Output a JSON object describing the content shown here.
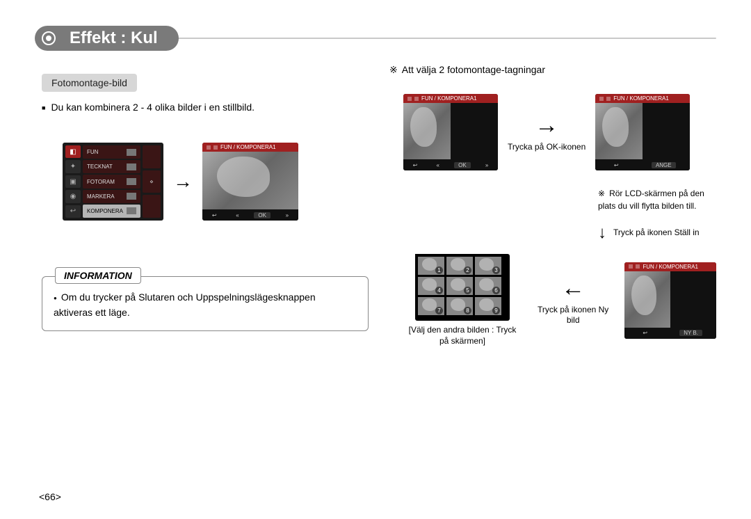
{
  "title": "Effekt : Kul",
  "subheading": "Fotomontage-bild",
  "intro_text": "Du kan kombinera 2 - 4 olika bilder i en stillbild.",
  "menu": {
    "items": [
      "FUN",
      "TECKNAT",
      "FOTORAM",
      "MARKERA",
      "KOMPONERA"
    ]
  },
  "screen_header": "FUN / KOMPONERA1",
  "footer_ok": "OK",
  "footer_ange": "ANGE",
  "footer_nyb": "NY B.",
  "info": {
    "label": "INFORMATION",
    "text": "Om du trycker på Slutaren och Uppspelningslägesknappen aktiveras ett läge."
  },
  "right": {
    "heading": "Att välja 2 fotomontage-tagningar",
    "step1_caption": "Trycka på OK-ikonen",
    "note": "Rör LCD-skärmen på den plats du vill flytta bilden till.",
    "step2_arrow_caption": "Tryck på ikonen Ställ in",
    "step3_caption": "Tryck på ikonen Ny bild",
    "grid_caption": "[Välj den andra bilden : Tryck på skärmen]"
  },
  "page_number": "<66>"
}
